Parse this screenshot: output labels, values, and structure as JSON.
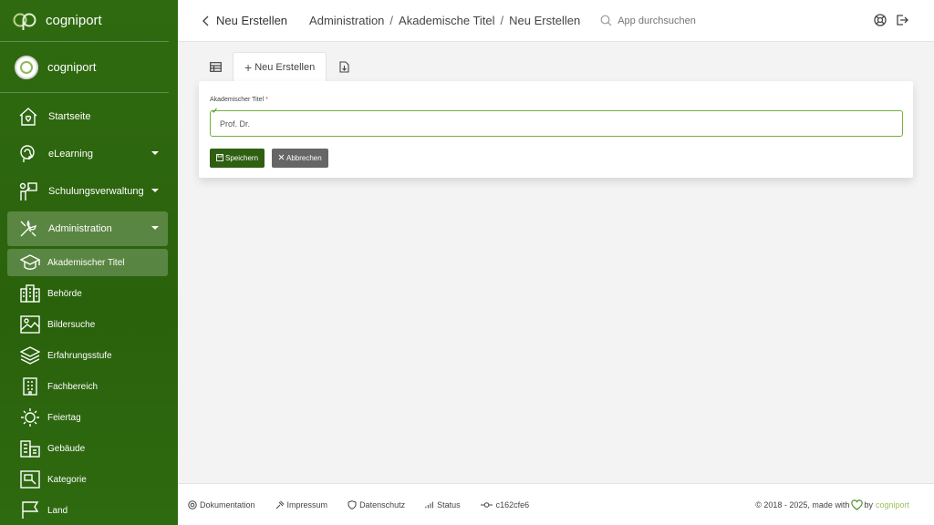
{
  "brand": {
    "name": "cogniport"
  },
  "user": {
    "name": "cogniport"
  },
  "sidebar": {
    "items": [
      {
        "label": "Startseite"
      },
      {
        "label": "eLearning"
      },
      {
        "label": "Schulungsverwaltung"
      },
      {
        "label": "Administration"
      }
    ],
    "subitems": [
      {
        "label": "Akademischer Titel"
      },
      {
        "label": "Behörde"
      },
      {
        "label": "Bildersuche"
      },
      {
        "label": "Erfahrungsstufe"
      },
      {
        "label": "Fachbereich"
      },
      {
        "label": "Feiertag"
      },
      {
        "label": "Gebäude"
      },
      {
        "label": "Kategorie"
      },
      {
        "label": "Land"
      }
    ]
  },
  "topbar": {
    "title": "Neu Erstellen",
    "breadcrumb": [
      "Administration",
      "Akademische Titel",
      "Neu Erstellen"
    ],
    "search_placeholder": "App durchsuchen"
  },
  "tabs": {
    "new_label": "Neu Erstellen"
  },
  "form": {
    "label": "Akademischer Titel",
    "required_mark": "*",
    "value": "Prof. Dr.",
    "save_label": "Speichern",
    "cancel_label": "Abbrechen"
  },
  "footer": {
    "links": [
      "Dokumentation",
      "Impressum",
      "Datenschutz",
      "Status",
      "c162cfe6"
    ],
    "copyright": "© 2018 - 2025, made with",
    "by": "by",
    "brand": "cogniport"
  },
  "colors": {
    "sidebar": "#2f6a10",
    "accent": "#9bc25e",
    "save_button": "#2f5f10",
    "cancel_button": "#666666"
  }
}
